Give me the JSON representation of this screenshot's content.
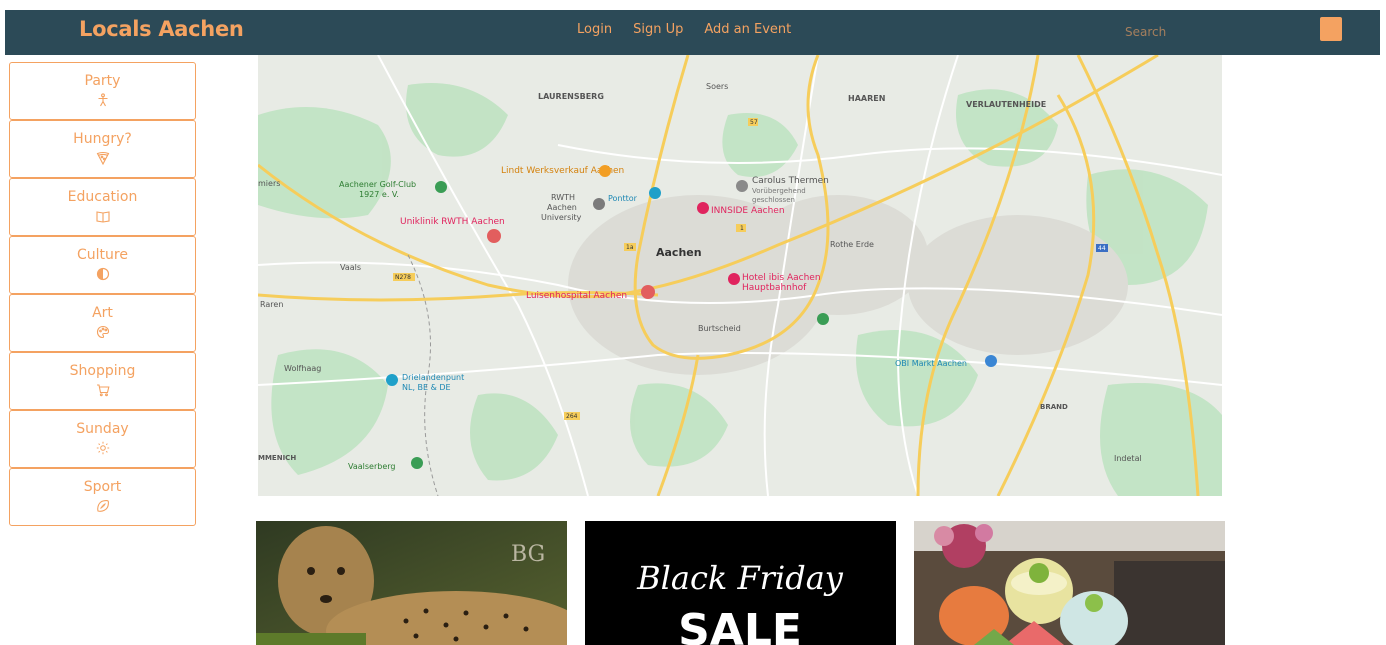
{
  "header": {
    "brand": "Locals Aachen",
    "nav": [
      "Login",
      "Sign Up",
      "Add an Event"
    ],
    "search_placeholder": "Search"
  },
  "sidebar": {
    "categories": [
      {
        "label": "Party",
        "icon": "person-icon"
      },
      {
        "label": "Hungry?",
        "icon": "pizza-icon"
      },
      {
        "label": "Education",
        "icon": "book-icon"
      },
      {
        "label": "Culture",
        "icon": "contrast-icon"
      },
      {
        "label": "Art",
        "icon": "palette-icon"
      },
      {
        "label": "Shopping",
        "icon": "cart-icon"
      },
      {
        "label": "Sunday",
        "icon": "sun-icon"
      },
      {
        "label": "Sport",
        "icon": "football-icon"
      }
    ]
  },
  "map": {
    "labels": {
      "city": "Aachen",
      "laurensberg": "LAURENSBERG",
      "soers": "Soers",
      "haaren": "HAAREN",
      "verlautenheide": "VERLAUTENHEIDE",
      "lindt": "Lindt Werksverkauf Aachen",
      "carolus": "Carolus Thermen",
      "carolus_sub1": "Vorübergehend",
      "carolus_sub2": "geschlossen",
      "golf1": "Aachener Golf-Club",
      "golf2": "1927 e. V.",
      "rwth1": "RWTH",
      "rwth2": "Aachen",
      "rwth3": "University",
      "ponttor": "Ponttor",
      "inside": "INNSIDE Aachen",
      "uniklinik": "Uniklinik RWTH Aachen",
      "rothe": "Rothe Erde",
      "vaals": "Vaals",
      "ibis1": "Hotel ibis Aachen",
      "ibis2": "Hauptbahnhof",
      "luisen": "Luisenhospital Aachen",
      "raren": "Raren",
      "burtscheid": "Burtscheid",
      "wolfhaag": "Wolfhaag",
      "drielanden1": "Drielandenpunt",
      "drielanden2": "NL, BE & DE",
      "obi": "OBI Markt Aachen",
      "brand": "BRAND",
      "mmenich": "MMENICH",
      "vaalserberg": "Vaalserberg",
      "indetal": "Indetal",
      "miers": "miers",
      "r57": "57",
      "r1": "1",
      "r1a": "1a",
      "r264": "264",
      "r44": "44",
      "n278": "N278"
    }
  },
  "cards": [
    {
      "name": "cheetah-card",
      "watermark": "BG"
    },
    {
      "name": "black-friday-card",
      "line1": "Black Friday",
      "line2": "SALE"
    },
    {
      "name": "drinks-card"
    }
  ],
  "colors": {
    "header_bg": "#2c4a57",
    "accent": "#f4a261"
  }
}
